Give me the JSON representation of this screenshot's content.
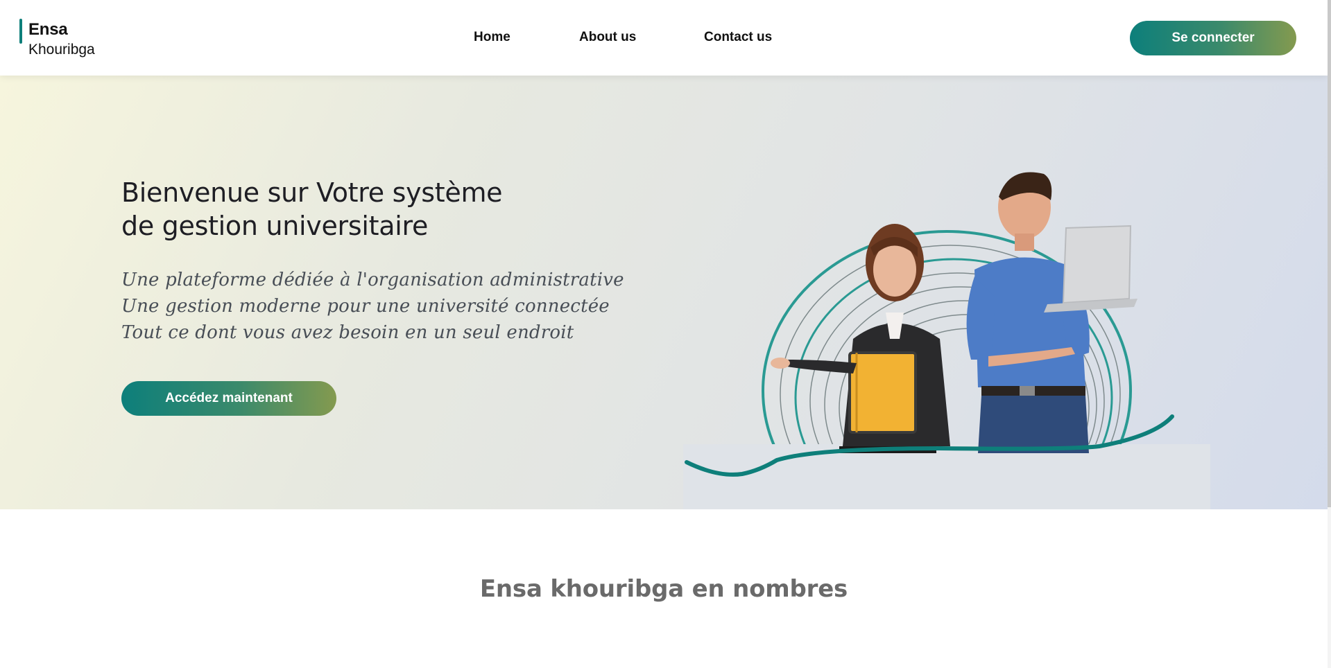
{
  "header": {
    "logo": {
      "line1": "Ensa",
      "line2": "Khouribga"
    },
    "nav": [
      {
        "label": "Home"
      },
      {
        "label": "About us"
      },
      {
        "label": "Contact us"
      }
    ],
    "login_button": "Se connecter"
  },
  "hero": {
    "title_line1": "Bienvenue sur Votre système",
    "title_line2": "de gestion universitaire",
    "subtitle_lines": [
      "Une plateforme dédiée à l'organisation administrative",
      "Une gestion moderne pour une université connectée",
      "Tout ce dont vous avez besoin en un seul endroit"
    ],
    "cta_button": "Accédez maintenant",
    "illustration_icon": "students-with-laptop-illustration"
  },
  "stats": {
    "title": "Ensa khouribga en nombres"
  },
  "colors": {
    "accent_teal": "#0d7f7b",
    "accent_olive": "#849a4f",
    "hero_bg_start": "#f6f5dd",
    "hero_bg_end": "#d4dbeb"
  }
}
